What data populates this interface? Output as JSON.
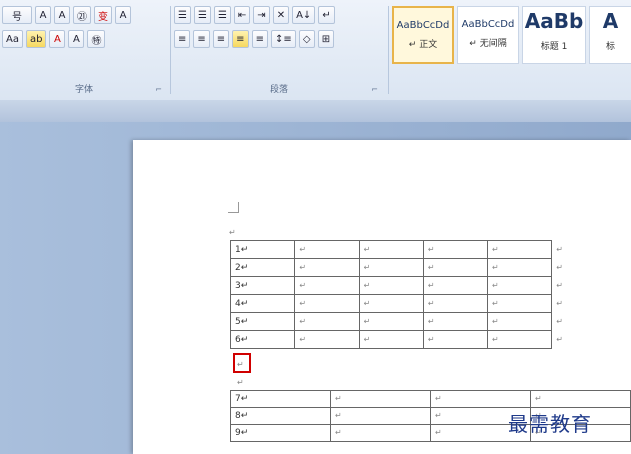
{
  "ribbon": {
    "font_group": {
      "label": "字体",
      "row1": [
        "号",
        "A",
        "A",
        "㉑",
        "变",
        "A"
      ],
      "row2": [
        "Aa",
        "ab",
        "A",
        "A",
        "㊕"
      ]
    },
    "paragraph_group": {
      "label": "段落",
      "row1": [
        "☰",
        "☰",
        "☰",
        "⇤",
        "⇥",
        "✕",
        "A↓",
        "↵"
      ],
      "row2": [
        "≡",
        "≡",
        "≡",
        "≡",
        "≡",
        "↕≡",
        "◇",
        "⊞"
      ]
    },
    "styles": [
      {
        "preview": "AaBbCcDd",
        "name": "↵ 正文",
        "selected": true
      },
      {
        "preview": "AaBbCcDd",
        "name": "↵ 无间隔",
        "selected": false
      },
      {
        "preview": "AaBb",
        "name": "标题 1",
        "selected": false
      },
      {
        "preview": "A",
        "name": "标",
        "selected": false
      }
    ]
  },
  "document": {
    "para_mark": "↵",
    "table1": {
      "rows": [
        [
          "1↵",
          "↵",
          "↵",
          "↵",
          "↵"
        ],
        [
          "2↵",
          "↵",
          "↵",
          "↵",
          "↵"
        ],
        [
          "3↵",
          "↵",
          "↵",
          "↵",
          "↵"
        ],
        [
          "4↵",
          "↵",
          "↵",
          "↵",
          "↵"
        ],
        [
          "5↵",
          "↵",
          "↵",
          "↵",
          "↵"
        ],
        [
          "6↵",
          "↵",
          "↵",
          "↵",
          "↵"
        ]
      ],
      "row_end": "↵"
    },
    "between_mark": "↵",
    "after_mark": "↵",
    "table2": {
      "rows": [
        [
          "7↵",
          "↵",
          "↵",
          "↵"
        ],
        [
          "8↵",
          "↵",
          "↵",
          "↵"
        ],
        [
          "9↵",
          "↵",
          "↵",
          "↵"
        ]
      ]
    }
  },
  "watermark": "最需教育",
  "colors": {
    "highlight_box": "#d00000",
    "watermark": "#1f3a8a"
  }
}
